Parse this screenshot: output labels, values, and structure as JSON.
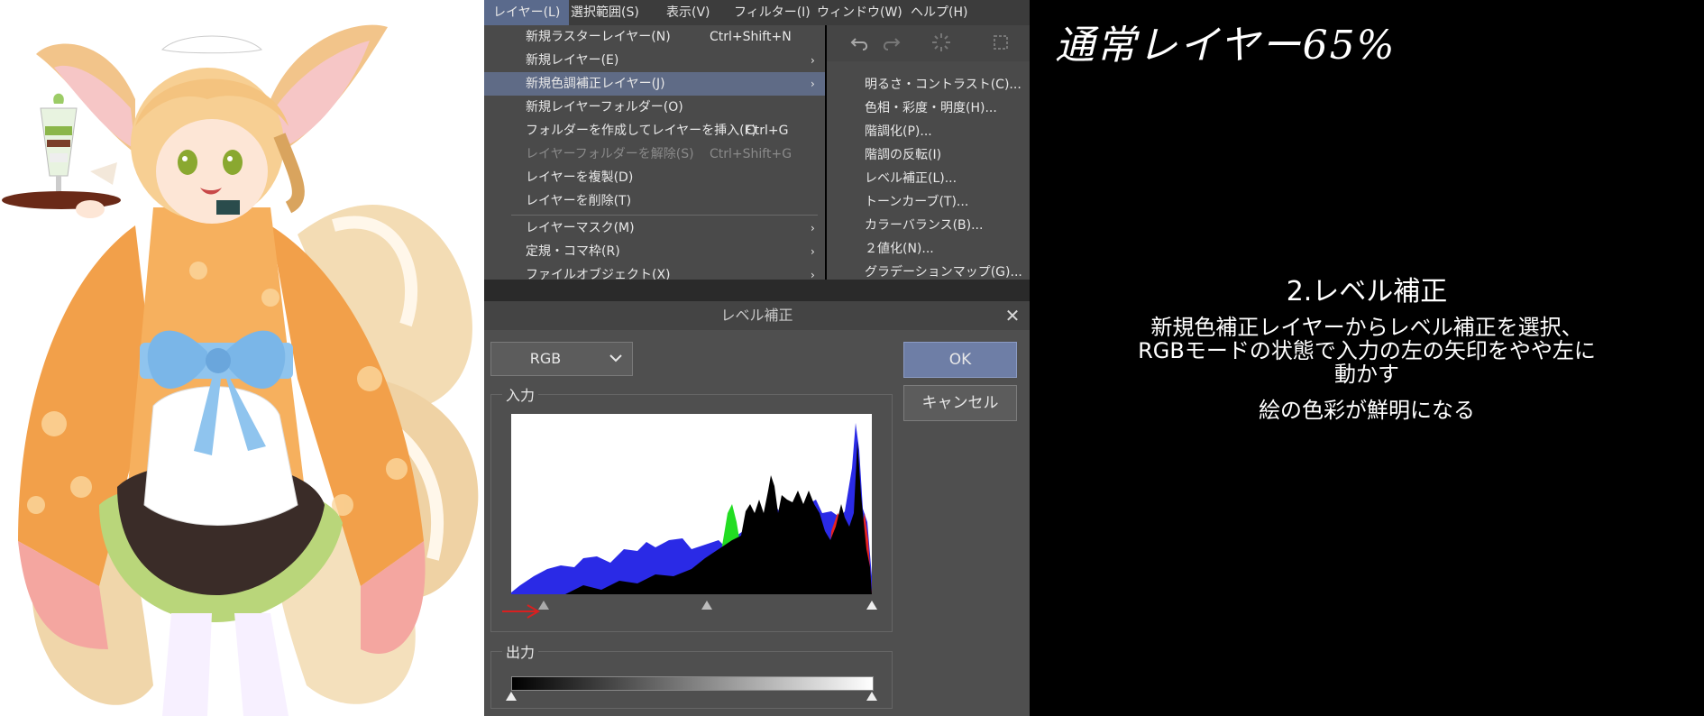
{
  "menubar": [
    {
      "label": "レイヤー(L)",
      "active": true
    },
    {
      "label": "選択範囲(S)"
    },
    {
      "label": "表示(V)"
    },
    {
      "label": "フィルター(I)"
    },
    {
      "label": "ウィンドウ(W)"
    },
    {
      "label": "ヘルプ(H)"
    }
  ],
  "layer_menu": [
    {
      "label": "新規ラスターレイヤー(N)",
      "shortcut": "Ctrl+Shift+N"
    },
    {
      "label": "新規レイヤー(E)",
      "submenu": true
    },
    {
      "label": "新規色調補正レイヤー(J)",
      "submenu": true,
      "highlighted": true
    },
    {
      "label": "新規レイヤーフォルダー(O)"
    },
    {
      "label": "フォルダーを作成してレイヤーを挿入(F)",
      "shortcut": "Ctrl+G"
    },
    {
      "label": "レイヤーフォルダーを解除(S)",
      "shortcut": "Ctrl+Shift+G",
      "disabled": true
    },
    {
      "label": "レイヤーを複製(D)"
    },
    {
      "label": "レイヤーを削除(T)"
    },
    {
      "label": "レイヤーマスク(M)",
      "submenu": true
    },
    {
      "label": "定規・コマ枠(R)",
      "submenu": true
    },
    {
      "label": "ファイルオブジェクト(X)",
      "submenu": true
    }
  ],
  "toolbar_icons": [
    "undo-icon",
    "redo-icon",
    "loading-icon",
    "transform-icon"
  ],
  "arrow_glyph": "›",
  "tone_submenu": [
    "明るさ・コントラスト(C)...",
    "色相・彩度・明度(H)...",
    "階調化(P)...",
    "階調の反転(I)",
    "レベル補正(L)...",
    "トーンカーブ(T)...",
    "カラーバランス(B)...",
    "２値化(N)...",
    "グラデーションマップ(G)..."
  ],
  "dialog": {
    "title": "レベル補正",
    "channel": "RGB",
    "ok": "OK",
    "cancel": "キャンセル",
    "input_label": "入力",
    "output_label": "出力"
  },
  "histogram": {
    "colors": {
      "blue": "#2a2ae6",
      "green": "#22dd22",
      "red": "#e62222",
      "black": "#000000"
    },
    "input_markers": [
      0.09,
      0.54,
      1.0
    ],
    "output_markers": [
      0.0,
      1.0
    ]
  },
  "annotation": {
    "handwriting": "通常レイヤー65%",
    "step_title": "2.レベル補正",
    "desc_lines": [
      "新規色補正レイヤーからレベル補正を選択、",
      "RGBモードの状態で入力の左の矢印をやや左に",
      "動かす"
    ],
    "result": "絵の色彩が鮮明になる"
  },
  "colors": {
    "menu_highlight": "#5f6b86",
    "ok_button": "#6e7ea6"
  }
}
